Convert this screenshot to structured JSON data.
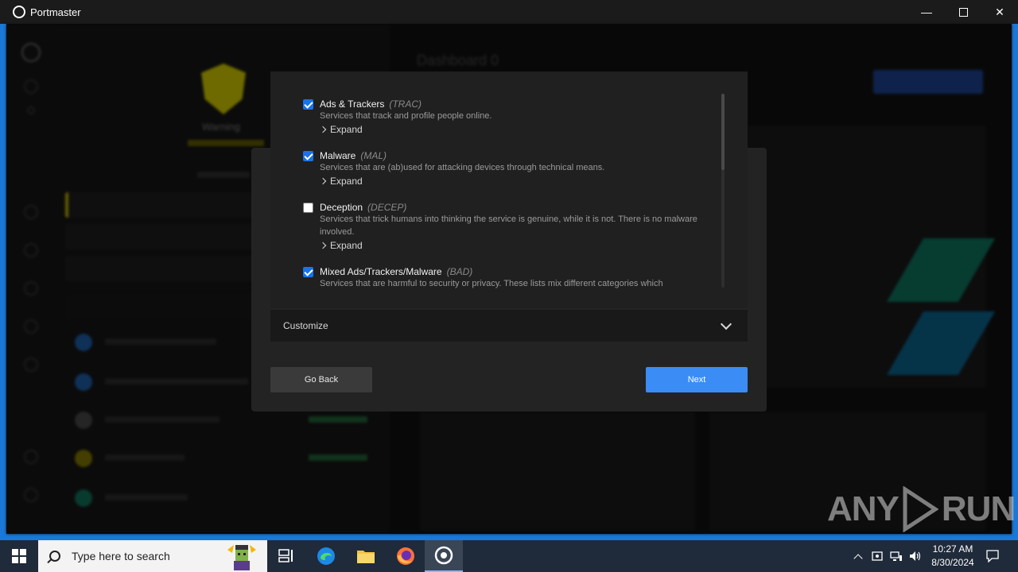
{
  "window": {
    "title": "Portmaster",
    "minimize": "—",
    "maximize": "☐",
    "close": "✕"
  },
  "background": {
    "status": "Warning",
    "dashboard_title": "Dashboard 0"
  },
  "dialog": {
    "items": [
      {
        "name": "Ads & Trackers",
        "code": "(TRAC)",
        "desc": "Services that track and profile people online.",
        "checked": true,
        "expand": "Expand"
      },
      {
        "name": "Malware",
        "code": "(MAL)",
        "desc": "Services that are (ab)used for attacking devices through technical means.",
        "checked": true,
        "expand": "Expand"
      },
      {
        "name": "Deception",
        "code": "(DECEP)",
        "desc": "Services that trick humans into thinking the service is genuine, while it is not. There is no malware involved.",
        "checked": false,
        "expand": "Expand"
      },
      {
        "name": "Mixed Ads/Trackers/Malware",
        "code": "(BAD)",
        "desc": "Services that are harmful to security or privacy. These lists mix different categories which",
        "checked": true
      }
    ],
    "customize_label": "Customize",
    "back_label": "Go Back",
    "next_label": "Next"
  },
  "taskbar": {
    "search_placeholder": "Type here to search",
    "time": "10:27 AM",
    "date": "8/30/2024"
  },
  "watermark": {
    "left": "ANY",
    "right": "RUN"
  },
  "colors": {
    "accent": "#3b8cf5",
    "checkbox": "#1a73e8",
    "frame": "#1978d8",
    "warning": "#c8c200"
  }
}
